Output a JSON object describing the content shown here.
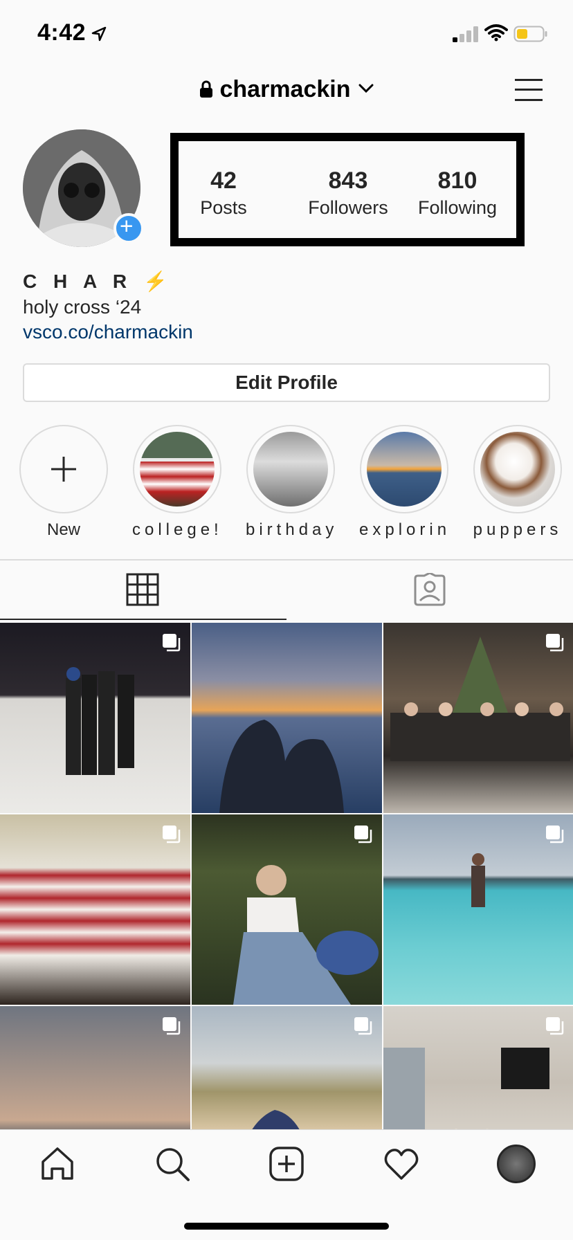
{
  "status_bar": {
    "time": "4:42"
  },
  "header": {
    "username": "charmackin"
  },
  "profile": {
    "stats": [
      {
        "value": "42",
        "label": "Posts"
      },
      {
        "value": "843",
        "label": "Followers"
      },
      {
        "value": "810",
        "label": "Following"
      }
    ],
    "name": "C H A R",
    "name_emoji": "⚡",
    "bio": "holy cross ‘24",
    "link": "vsco.co/charmackin",
    "edit_button": "Edit Profile"
  },
  "highlights": [
    {
      "label": "New"
    },
    {
      "label": "college!"
    },
    {
      "label": "birthday"
    },
    {
      "label": "explorin"
    },
    {
      "label": "puppers"
    }
  ],
  "posts": [
    {
      "scene": "ice-rink-night",
      "multi": true
    },
    {
      "scene": "sunset-ocean",
      "multi": false
    },
    {
      "scene": "christmas-tree-group",
      "multi": true
    },
    {
      "scene": "striped-shirt-group",
      "multi": true
    },
    {
      "scene": "lawn-laughing",
      "multi": true
    },
    {
      "scene": "swimming-pool",
      "multi": true
    },
    {
      "scene": "beach-dusk",
      "multi": true
    },
    {
      "scene": "sand-dunes",
      "multi": true
    },
    {
      "scene": "living-room",
      "multi": true
    }
  ],
  "colors": {
    "accent": "#3897f0",
    "link": "#00376b",
    "battery": "#f5c518"
  }
}
